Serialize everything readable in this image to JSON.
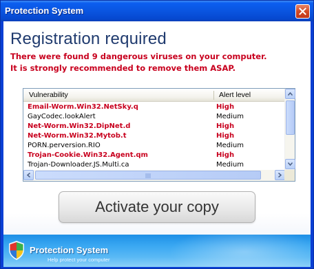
{
  "window": {
    "title": "Protection System",
    "close_icon": "close-icon"
  },
  "main": {
    "heading": "Registration required",
    "warning_line1": "There were found 9 dangerous viruses on your computer.",
    "warning_line2": "It is strongly recommended to remove them ASAP."
  },
  "table": {
    "headers": [
      "Vulnerability",
      "Alert level"
    ],
    "rows": [
      {
        "name": "Email-Worm.Win32.NetSky.q",
        "level": "High",
        "danger": true
      },
      {
        "name": "GayCodec.lookAlert",
        "level": "Medium",
        "danger": false
      },
      {
        "name": "Net-Worm.Win32.DipNet.d",
        "level": "High",
        "danger": true
      },
      {
        "name": "Net-Worm.Win32.Mytob.t",
        "level": "High",
        "danger": true
      },
      {
        "name": "PORN.perversion.RIO",
        "level": "Medium",
        "danger": false
      },
      {
        "name": "Trojan-Cookie.Win32.Agent.qm",
        "level": "High",
        "danger": true
      },
      {
        "name": "Trojan-Downloader.JS.Multi.ca",
        "level": "Medium",
        "danger": false
      }
    ],
    "colors": {
      "danger": "#c8001e",
      "normal": "#000000"
    }
  },
  "actions": {
    "activate_label": "Activate your copy"
  },
  "footer": {
    "title": "Protection System",
    "subtitle": "Help protect your computer",
    "shield_icon": "shield-icon"
  },
  "colors": {
    "titlebar": "#0a55e0",
    "heading": "#1f3a6e",
    "warning": "#c8001e",
    "footer": "#3aa8f2"
  }
}
